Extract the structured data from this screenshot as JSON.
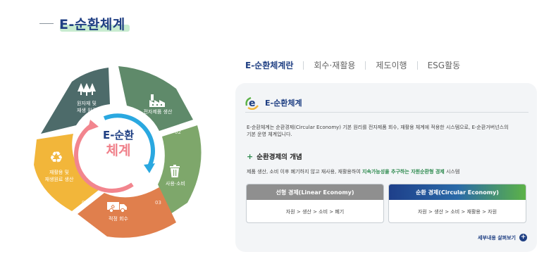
{
  "header": {
    "title": "E-순환체계"
  },
  "cycle": {
    "center_top": "E-순환",
    "center_bottom": "체계",
    "segments": [
      {
        "num": "01",
        "label_1": "원자재 및",
        "label_2": "재생 원료",
        "icon": "trees-icon",
        "color": "#4d6b6a"
      },
      {
        "num": "01",
        "label_1": "전자제품 생산",
        "label_2": "",
        "icon": "factory-icon",
        "color": "#5f8a6a"
      },
      {
        "num": "02",
        "label_1": "사용·소비",
        "label_2": "",
        "icon": "trash-bin-icon",
        "color": "#7ea76b"
      },
      {
        "num": "03",
        "label_1": "적정 회수",
        "label_2": "",
        "icon": "truck-icon",
        "color": "#e07f4d"
      },
      {
        "num": "05",
        "label_1": "재활용 및",
        "label_2": "재생원료 생산",
        "icon": "recycle-icon",
        "color": "#f2b63a"
      }
    ],
    "extra_num": "04",
    "arrow_colors": {
      "blue": "#2aa8e0",
      "pink": "#f2858e"
    }
  },
  "tabs": [
    {
      "label": "E-순환체계란",
      "active": true
    },
    {
      "label": "회수·재활용",
      "active": false
    },
    {
      "label": "제도이행",
      "active": false
    },
    {
      "label": "ESG활동",
      "active": false
    }
  ],
  "panel": {
    "title": "E-순환체계",
    "desc_line1": "E-순환체계는 순환경제(Circular Economy) 기본 원리를 전자제품 회수, 재활용 체계에 적용한 시스템으로, E-순환거버넌스의",
    "desc_line2": "기본 운영 체계입니다.",
    "section_title": "순환경제의 개념",
    "section_desc_pre": "제품 생산, 소비 이후 폐기하지 않고 재사용, 재활용하여 ",
    "section_desc_hl": "지속가능성을 추구하는 자원순환형 경제",
    "section_desc_post": " 시스템",
    "linear": {
      "title": "선형 경제(Linear Economy)",
      "flow": "자원 > 생산 > 소비 > 폐기"
    },
    "circular": {
      "title": "순환 경제(Circular Economy)",
      "flow": "자원 > 생산 > 소비 > 재활용 > 자원"
    },
    "more_label": "세부내용 살펴보기"
  }
}
